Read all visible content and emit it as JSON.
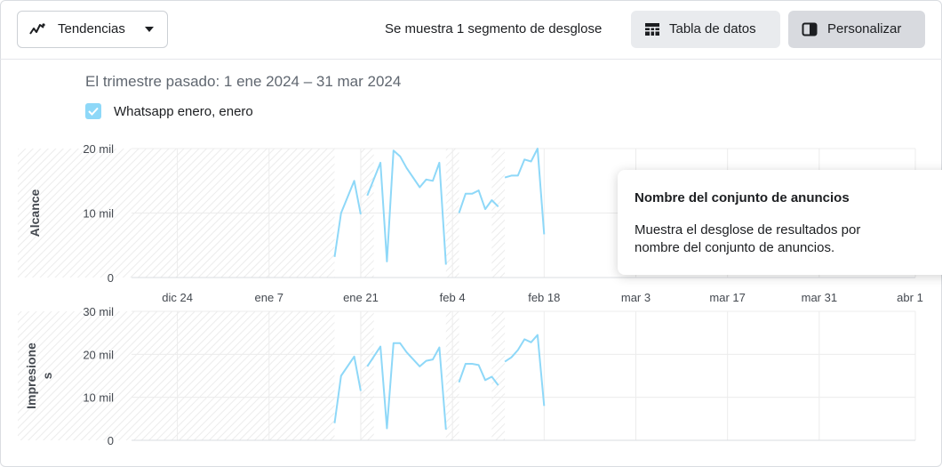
{
  "toolbar": {
    "view_label": "Tendencias",
    "segment_text": "Se muestra 1 segmento de desglose",
    "table_label": "Tabla de datos",
    "customize_label": "Personalizar"
  },
  "date_range": "El trimestre pasado: 1 ene 2024 – 31 mar 2024",
  "legend_label": "Whatsapp enero, enero",
  "tooltip": {
    "title": "Nombre del conjunto de anuncios",
    "body": "Muestra el desglose de resultados por nombre del conjunto de anuncios."
  },
  "colors": {
    "series": "#8ed8f8",
    "accent": "#8ed8f8"
  },
  "chart_data": [
    {
      "type": "line",
      "ylabel": "Alcance",
      "ylim": [
        0,
        20000
      ],
      "yticks": [
        "0",
        "10 mil",
        "20 mil"
      ],
      "x_ticks": [
        "dic 24",
        "ene 7",
        "ene 21",
        "feb 4",
        "feb 18",
        "mar 3",
        "mar 17",
        "mar 31",
        "abr 1"
      ],
      "series": [
        {
          "name": "Whatsapp enero, enero",
          "segments": [
            [
              [
                "2024-01-17",
                3200
              ],
              [
                "2024-01-18",
                10000
              ],
              [
                "2024-01-20",
                15000
              ],
              [
                "2024-01-21",
                9800
              ]
            ],
            [
              [
                "2024-01-22",
                12700
              ],
              [
                "2024-01-24",
                17800
              ],
              [
                "2024-01-25",
                2500
              ],
              [
                "2024-01-26",
                19700
              ],
              [
                "2024-01-27",
                18800
              ],
              [
                "2024-01-28",
                17000
              ],
              [
                "2024-01-30",
                14000
              ],
              [
                "2024-01-31",
                15200
              ],
              [
                "2024-02-01",
                15000
              ],
              [
                "2024-02-02",
                17800
              ],
              [
                "2024-02-03",
                2000
              ]
            ],
            [
              [
                "2024-02-05",
                10000
              ],
              [
                "2024-02-06",
                13000
              ],
              [
                "2024-02-07",
                13000
              ],
              [
                "2024-02-08",
                13500
              ],
              [
                "2024-02-09",
                10600
              ],
              [
                "2024-02-10",
                12000
              ],
              [
                "2024-02-11",
                11000
              ]
            ],
            [
              [
                "2024-02-12",
                15500
              ],
              [
                "2024-02-13",
                15800
              ],
              [
                "2024-02-14",
                15800
              ],
              [
                "2024-02-15",
                18300
              ],
              [
                "2024-02-16",
                18000
              ],
              [
                "2024-02-17",
                20000
              ],
              [
                "2024-02-18",
                6700
              ]
            ]
          ]
        }
      ]
    },
    {
      "type": "line",
      "ylabel": "Impresiones",
      "ylim": [
        0,
        30000
      ],
      "yticks": [
        "0",
        "10 mil",
        "20 mil",
        "30 mil"
      ],
      "x_ticks": [],
      "series": [
        {
          "name": "Whatsapp enero, enero",
          "segments": [
            [
              [
                "2024-01-17",
                4000
              ],
              [
                "2024-01-18",
                15000
              ],
              [
                "2024-01-20",
                19500
              ],
              [
                "2024-01-21",
                11500
              ]
            ],
            [
              [
                "2024-01-22",
                17200
              ],
              [
                "2024-01-24",
                21800
              ],
              [
                "2024-01-25",
                2800
              ],
              [
                "2024-01-26",
                22600
              ],
              [
                "2024-01-27",
                22600
              ],
              [
                "2024-01-28",
                20500
              ],
              [
                "2024-01-30",
                17200
              ],
              [
                "2024-01-31",
                18500
              ],
              [
                "2024-02-01",
                18800
              ],
              [
                "2024-02-02",
                21600
              ],
              [
                "2024-02-03",
                2500
              ]
            ],
            [
              [
                "2024-02-05",
                13500
              ],
              [
                "2024-02-06",
                17800
              ],
              [
                "2024-02-07",
                17800
              ],
              [
                "2024-02-08",
                17500
              ],
              [
                "2024-02-09",
                14000
              ],
              [
                "2024-02-10",
                14800
              ],
              [
                "2024-02-11",
                12800
              ]
            ],
            [
              [
                "2024-02-12",
                18300
              ],
              [
                "2024-02-13",
                19300
              ],
              [
                "2024-02-14",
                21000
              ],
              [
                "2024-02-15",
                23500
              ],
              [
                "2024-02-16",
                22800
              ],
              [
                "2024-02-17",
                24500
              ],
              [
                "2024-02-18",
                8000
              ]
            ]
          ]
        }
      ]
    }
  ]
}
